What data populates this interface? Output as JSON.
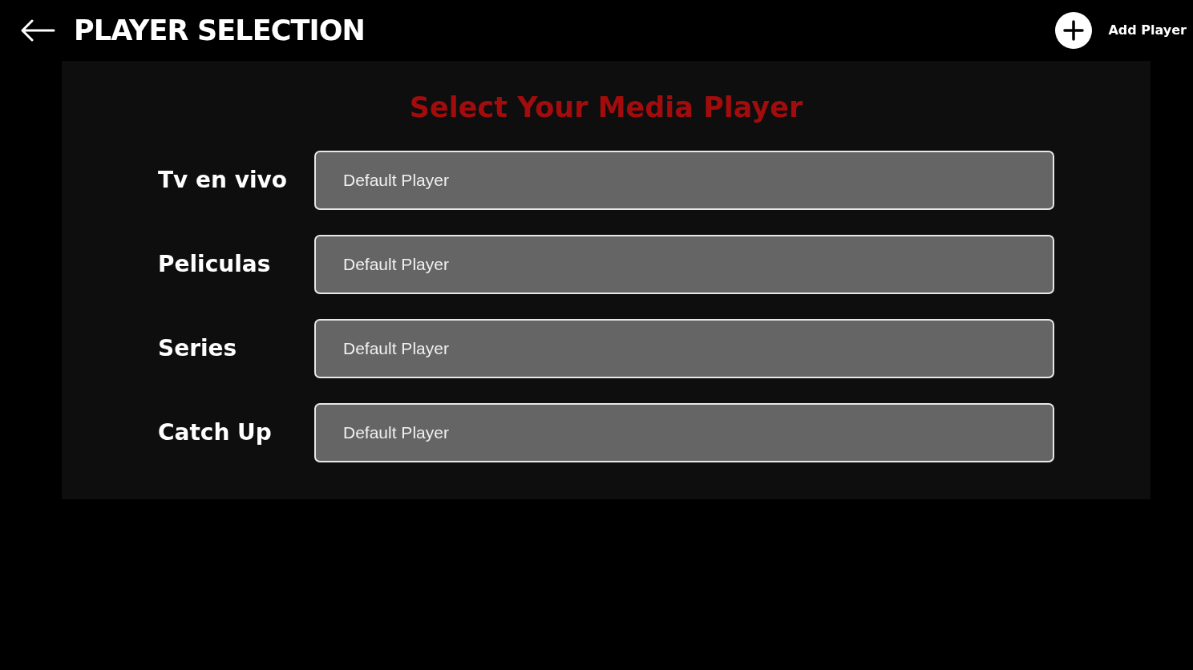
{
  "header": {
    "title": "PLAYER SELECTION",
    "add_label": "Add Player"
  },
  "panel": {
    "title": "Select Your Media Player",
    "rows": [
      {
        "label": "Tv en vivo",
        "value": "Default Player"
      },
      {
        "label": "Peliculas",
        "value": "Default Player"
      },
      {
        "label": "Series",
        "value": "Default Player"
      },
      {
        "label": "Catch Up",
        "value": "Default Player"
      }
    ]
  }
}
